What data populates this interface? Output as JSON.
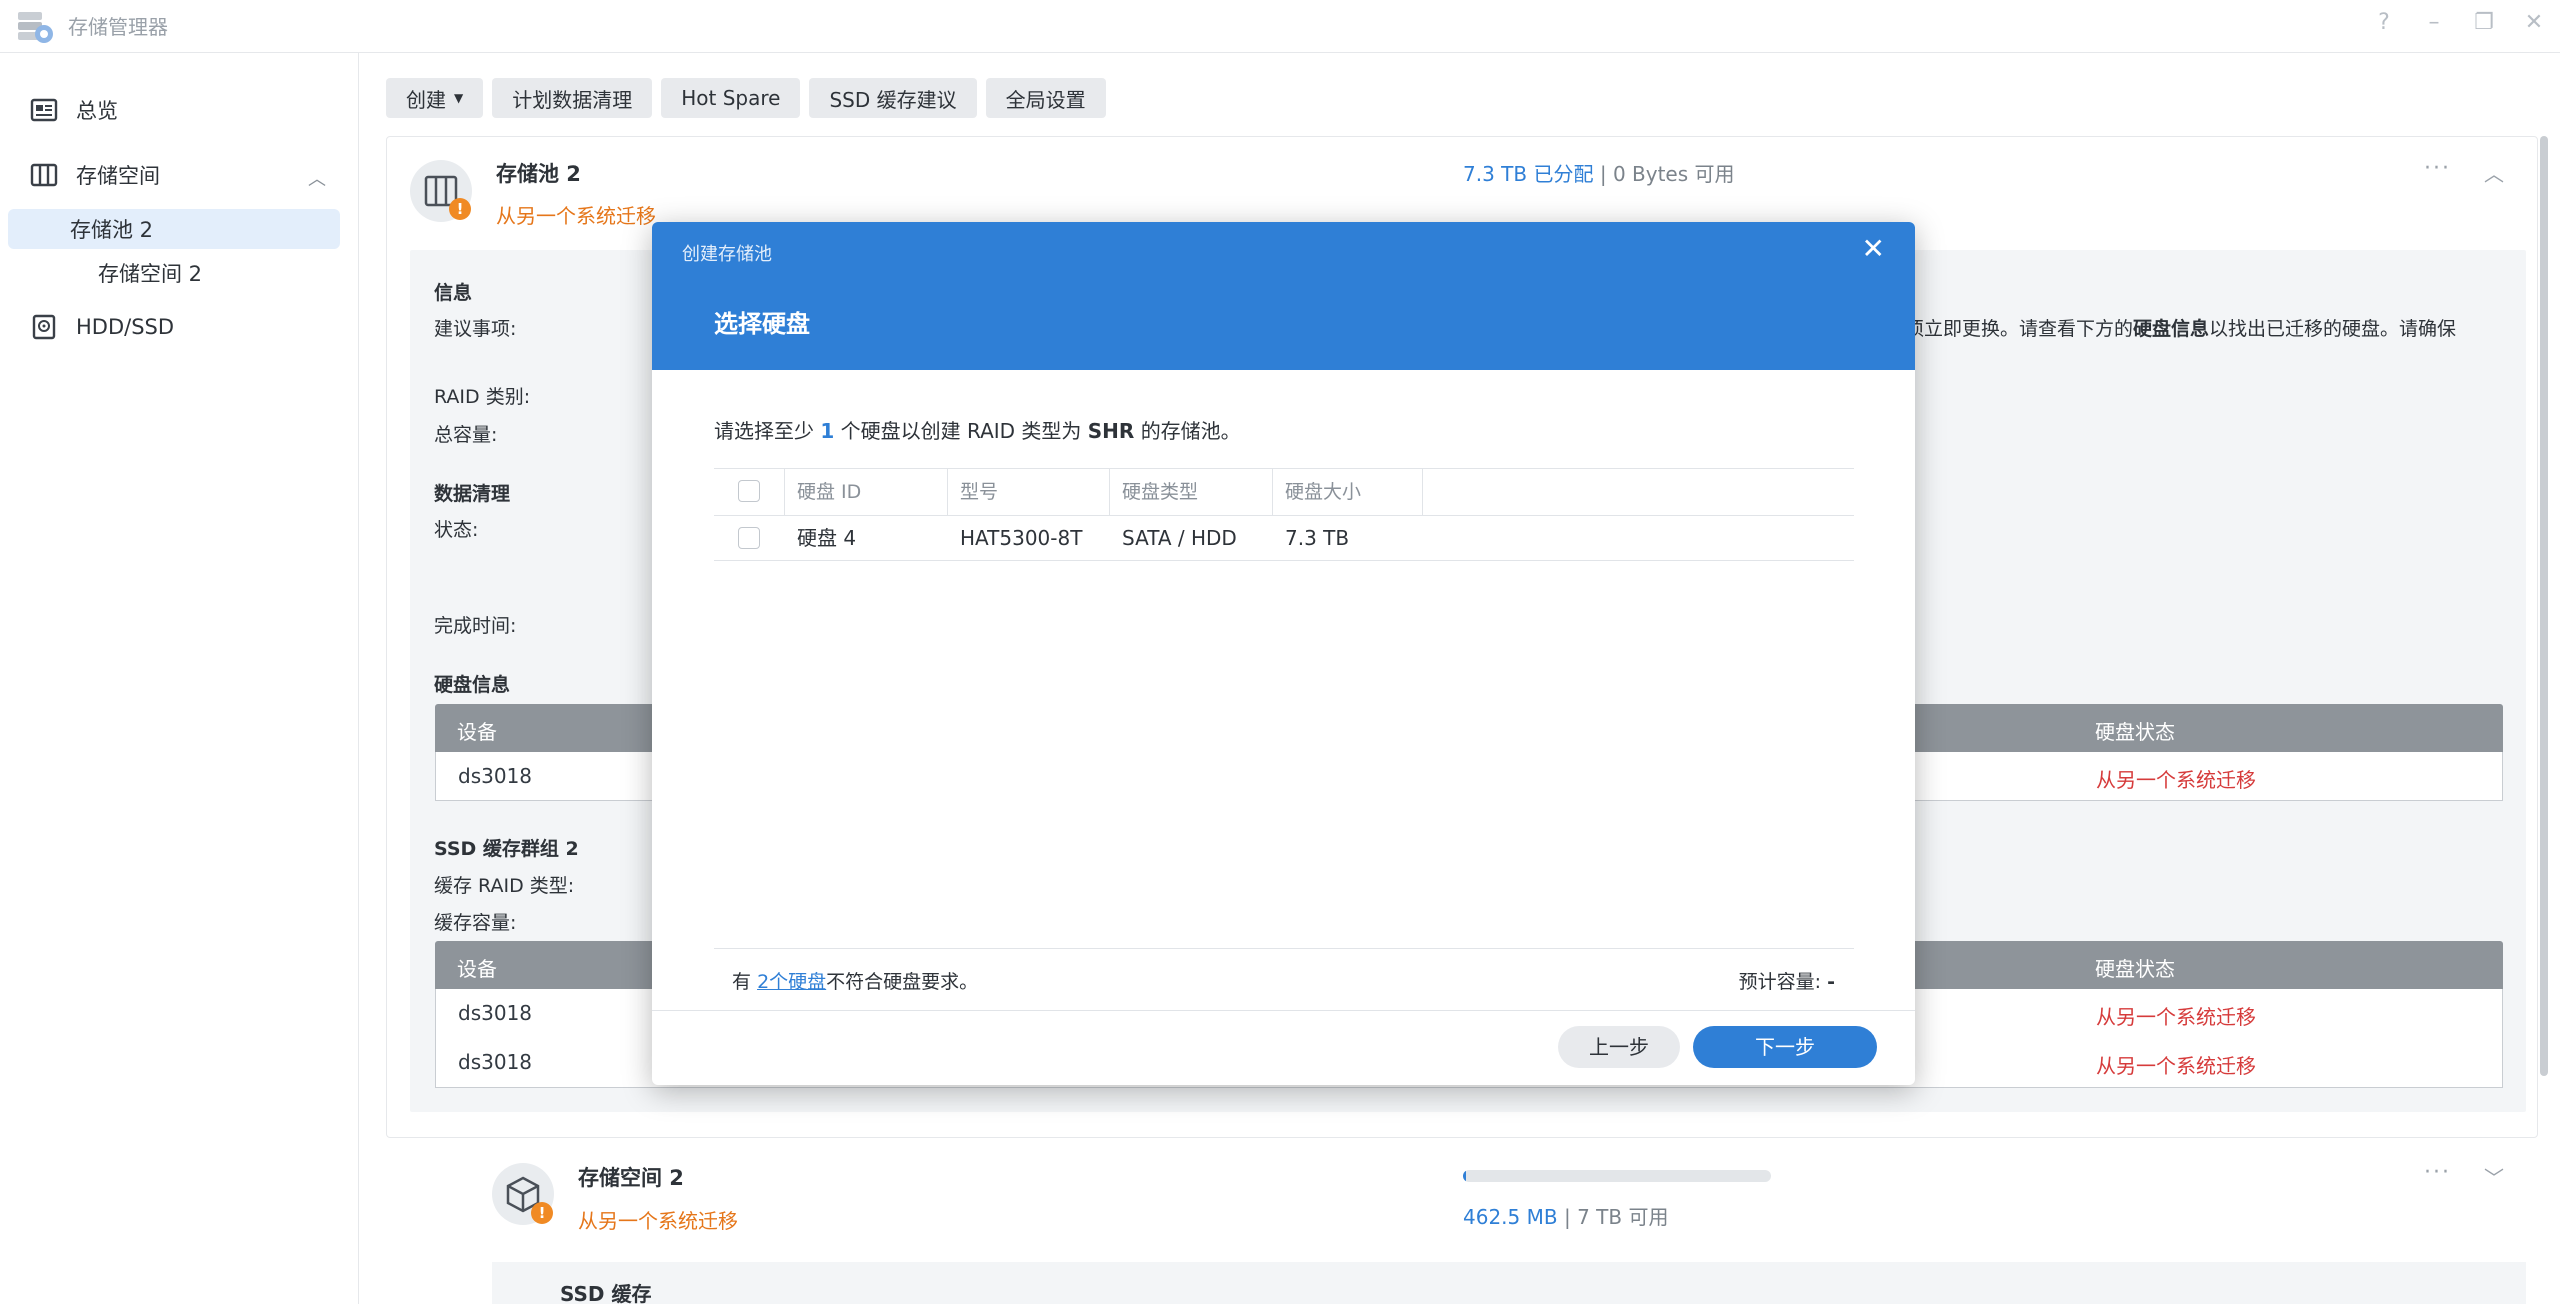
{
  "app": {
    "title": "存储管理器",
    "icons": [
      "help-icon",
      "minimize-icon",
      "restore-icon",
      "close-icon"
    ]
  },
  "sidebar": {
    "items": [
      {
        "label": "总览",
        "icon": "overview-icon"
      },
      {
        "label": "存储空间",
        "icon": "storage-icon"
      },
      {
        "label": "存储池 2"
      },
      {
        "label": "存储空间 2"
      },
      {
        "label": "HDD/SSD",
        "icon": "disk-icon"
      }
    ]
  },
  "toolbar": {
    "create": "创建",
    "scrub": "计划数据清理",
    "hot_spare": "Hot Spare",
    "ssd_cache": "SSD 缓存建议",
    "global_settings": "全局设置"
  },
  "pool": {
    "title": "存储池 2",
    "status": "从另一个系统迁移",
    "allocated": "7.3 TB 已分配",
    "separator": "|",
    "available": "0 Bytes 可用",
    "more": "···"
  },
  "detail": {
    "info_heading": "信息",
    "suggestion_label": "建议事项:",
    "suggestion_text_pre": "须立即更换。请查看下方的",
    "suggestion_bold": "硬盘信息",
    "suggestion_text_post": "以找出已迁移的硬盘。请确保",
    "raid_type_label": "RAID 类别:",
    "total_capacity_label": "总容量:",
    "scrub_heading": "数据清理",
    "status_label": "状态:",
    "finish_time_label": "完成时间:",
    "disk_info_heading": "硬盘信息",
    "disk_table": {
      "col_device": "设备",
      "col_status": "硬盘状态",
      "rows": [
        {
          "device": "ds3018",
          "status": "从另一个系统迁移"
        }
      ]
    },
    "ssd_group_heading": "SSD 缓存群组 2",
    "cache_raid_label": "缓存 RAID 类型:",
    "cache_capacity_label": "缓存容量:",
    "ssd_table": {
      "col_device": "设备",
      "col_status": "硬盘状态",
      "rows": [
        {
          "device": "ds3018",
          "status": "从另一个系统迁移"
        },
        {
          "device": "ds3018",
          "status": "从另一个系统迁移"
        }
      ]
    }
  },
  "volume": {
    "title": "存储空间 2",
    "status": "从另一个系统迁移",
    "used": "462.5 MB",
    "separator": "|",
    "available": "7 TB 可用",
    "usage_fraction": 0.01,
    "ssd_cache_label": "SSD 缓存",
    "more": "···"
  },
  "modal": {
    "header_small": "创建存储池",
    "title": "选择硬盘",
    "close": "✕",
    "desc_pre": "请选择至少",
    "desc_count": "1",
    "desc_mid": "个硬盘以创建 RAID 类型为",
    "desc_raid": "SHR",
    "desc_post": "的存储池。",
    "columns": {
      "disk_id": "硬盘 ID",
      "model": "型号",
      "type": "硬盘类型",
      "size": "硬盘大小"
    },
    "rows": [
      {
        "disk_id": "硬盘 4",
        "model": "HAT5300-8T",
        "type": "SATA / HDD",
        "size": "7.3 TB"
      }
    ],
    "footer_pre": "有",
    "footer_link": "2个硬盘",
    "footer_post": "不符合硬盘要求。",
    "est_label": "预计容量:",
    "est_value": "-",
    "btn_prev": "上一步",
    "btn_next": "下一步"
  }
}
